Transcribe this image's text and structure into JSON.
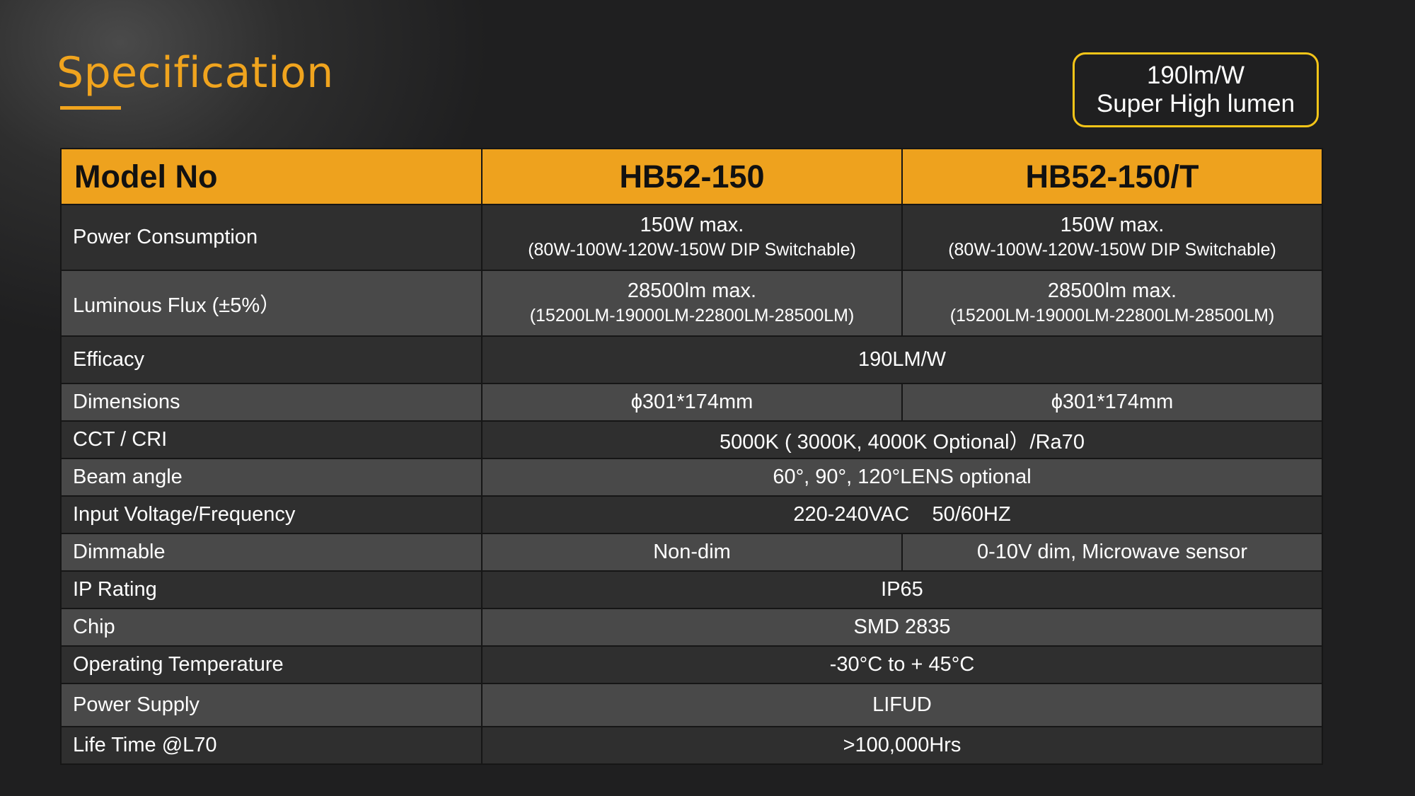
{
  "header": {
    "title": "Specification",
    "badge_line1": "190lm/W",
    "badge_line2": "Super High lumen"
  },
  "colors": {
    "accent": "#eea21e",
    "badge_border": "#f5c518",
    "row_dark": "#2f2f2f",
    "row_light": "#494949"
  },
  "table": {
    "headers": [
      "Model No",
      "HB52-150",
      "HB52-150/T"
    ],
    "rows": [
      {
        "label": "Power Consumption",
        "c1_main": "150W max.",
        "c1_sub": "(80W-100W-120W-150W DIP Switchable)",
        "c2_main": "150W max.",
        "c2_sub": "(80W-100W-120W-150W DIP Switchable)"
      },
      {
        "label": "Luminous Flux (±5%）",
        "c1_main": "28500lm max.",
        "c1_sub": "(15200LM-19000LM-22800LM-28500LM)",
        "c2_main": "28500lm max.",
        "c2_sub": "(15200LM-19000LM-22800LM-28500LM)"
      },
      {
        "label": "Efficacy",
        "value": "190LM/W"
      },
      {
        "label": "Dimensions",
        "c1": "ϕ301*174mm",
        "c2": "ϕ301*174mm"
      },
      {
        "label": "CCT / CRI",
        "value": "5000K ( 3000K, 4000K Optional）/Ra70"
      },
      {
        "label": "Beam angle",
        "value": "60°, 90°, 120°LENS optional"
      },
      {
        "label": "Input Voltage/Frequency",
        "value": "220-240VAC    50/60HZ"
      },
      {
        "label": "Dimmable",
        "c1": "Non-dim",
        "c2": "0-10V dim, Microwave sensor"
      },
      {
        "label": "IP Rating",
        "value": "IP65"
      },
      {
        "label": "Chip",
        "value": "SMD 2835"
      },
      {
        "label": "Operating Temperature",
        "value": "-30°C to + 45°C"
      },
      {
        "label": "Power Supply",
        "value": "LIFUD"
      },
      {
        "label": "Life Time @L70",
        "value": ">100,000Hrs"
      }
    ]
  }
}
